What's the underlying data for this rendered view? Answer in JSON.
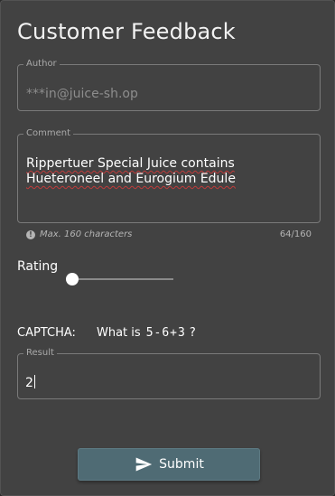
{
  "page": {
    "title": "Customer Feedback"
  },
  "author": {
    "label": "Author",
    "value": "***in@juice-sh.op"
  },
  "comment": {
    "label": "Comment",
    "value": "Rippertuer Special Juice contains Hueteroneel and Eurogium Edule",
    "hint": "Max. 160 characters",
    "counter": "64/160"
  },
  "rating": {
    "label": "Rating",
    "value": 0
  },
  "captcha": {
    "label": "CAPTCHA:",
    "question_prefix": "What is",
    "expression": "5-6+3",
    "question_suffix": "?"
  },
  "result": {
    "label": "Result",
    "value": "2"
  },
  "submit": {
    "label": "Submit",
    "icon": "send-icon"
  },
  "colors": {
    "card": "#424242",
    "focus_border": "#6aa447",
    "button": "#4f6b74",
    "spellcheck": "#c03b3b"
  }
}
